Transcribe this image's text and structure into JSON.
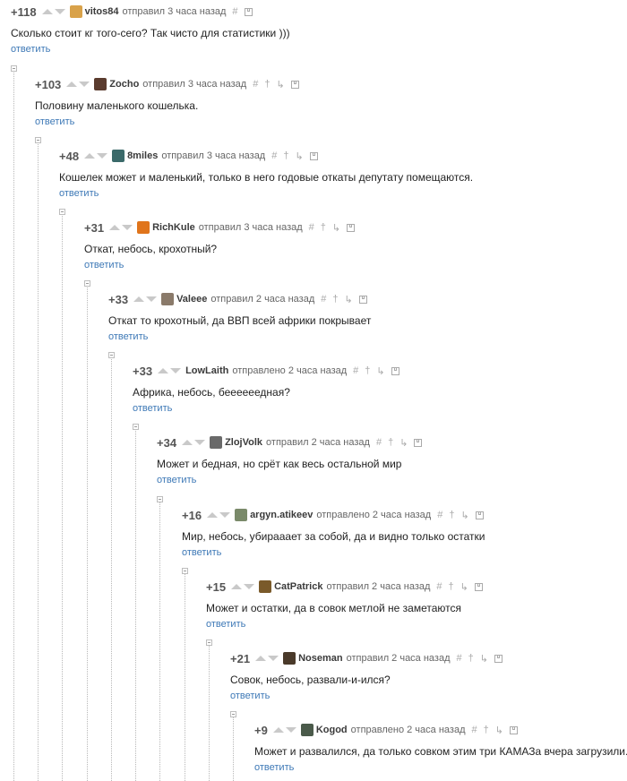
{
  "ui": {
    "reply_label": "ответить",
    "pin_icon": "dagger-icon",
    "link_icon": "hash-icon",
    "save_icon": "floppy-icon"
  },
  "comments": [
    {
      "rating": "+118",
      "author": "vitos84",
      "time": "отправил 3 часа назад",
      "text": "Сколько стоит кг того-сего? Так чисто для статистики )))",
      "avatar_color": "#d9a24a"
    },
    {
      "rating": "+103",
      "author": "Zocho",
      "time": "отправил 3 часа назад",
      "text": "Половину маленького кошелька.",
      "avatar_color": "#5a3b2e"
    },
    {
      "rating": "+48",
      "author": "8miles",
      "time": "отправил 3 часа назад",
      "text": "Кошелек может и маленький, только в него годовые откаты депутату помещаются.",
      "avatar_color": "#3b6a6a"
    },
    {
      "rating": "+31",
      "author": "RichKule",
      "time": "отправил 3 часа назад",
      "text": "Откат, небось, крохотный?",
      "avatar_color": "#e0751c"
    },
    {
      "rating": "+33",
      "author": "Valeee",
      "time": "отправил 2 часа назад",
      "text": "Откат то крохотный, да ВВП всей африки покрывает",
      "avatar_color": "#8a7a6a"
    },
    {
      "rating": "+33",
      "author": "LowLaith",
      "time": "отправлено 2 часа назад",
      "text": "Африка, небось, беееееедная?",
      "avatar_color": ""
    },
    {
      "rating": "+34",
      "author": "ZlojVolk",
      "time": "отправил 2 часа назад",
      "text": "Может и бедная, но срёт как весь остальной мир",
      "avatar_color": "#6a6a6a"
    },
    {
      "rating": "+16",
      "author": "argyn.atikeev",
      "time": "отправлено 2 часа назад",
      "text": "Мир, небось, убирааает за собой, да и видно только остатки",
      "avatar_color": "#7a8a6a"
    },
    {
      "rating": "+15",
      "author": "CatPatrick",
      "time": "отправил 2 часа назад",
      "text": "Может и остатки, да в совок метлой не заметаются",
      "avatar_color": "#7a5a2a"
    },
    {
      "rating": "+21",
      "author": "Noseman",
      "time": "отправил 2 часа назад",
      "text": "Совок, небось, развали-и-ился?",
      "avatar_color": "#4a3a2a"
    },
    {
      "rating": "+9",
      "author": "Kogod",
      "time": "отправлено 2 часа назад",
      "text": "Может и развалился, да только совком этим три КАМАЗа вчера загрузили.",
      "avatar_color": "#4a5a4a"
    }
  ]
}
